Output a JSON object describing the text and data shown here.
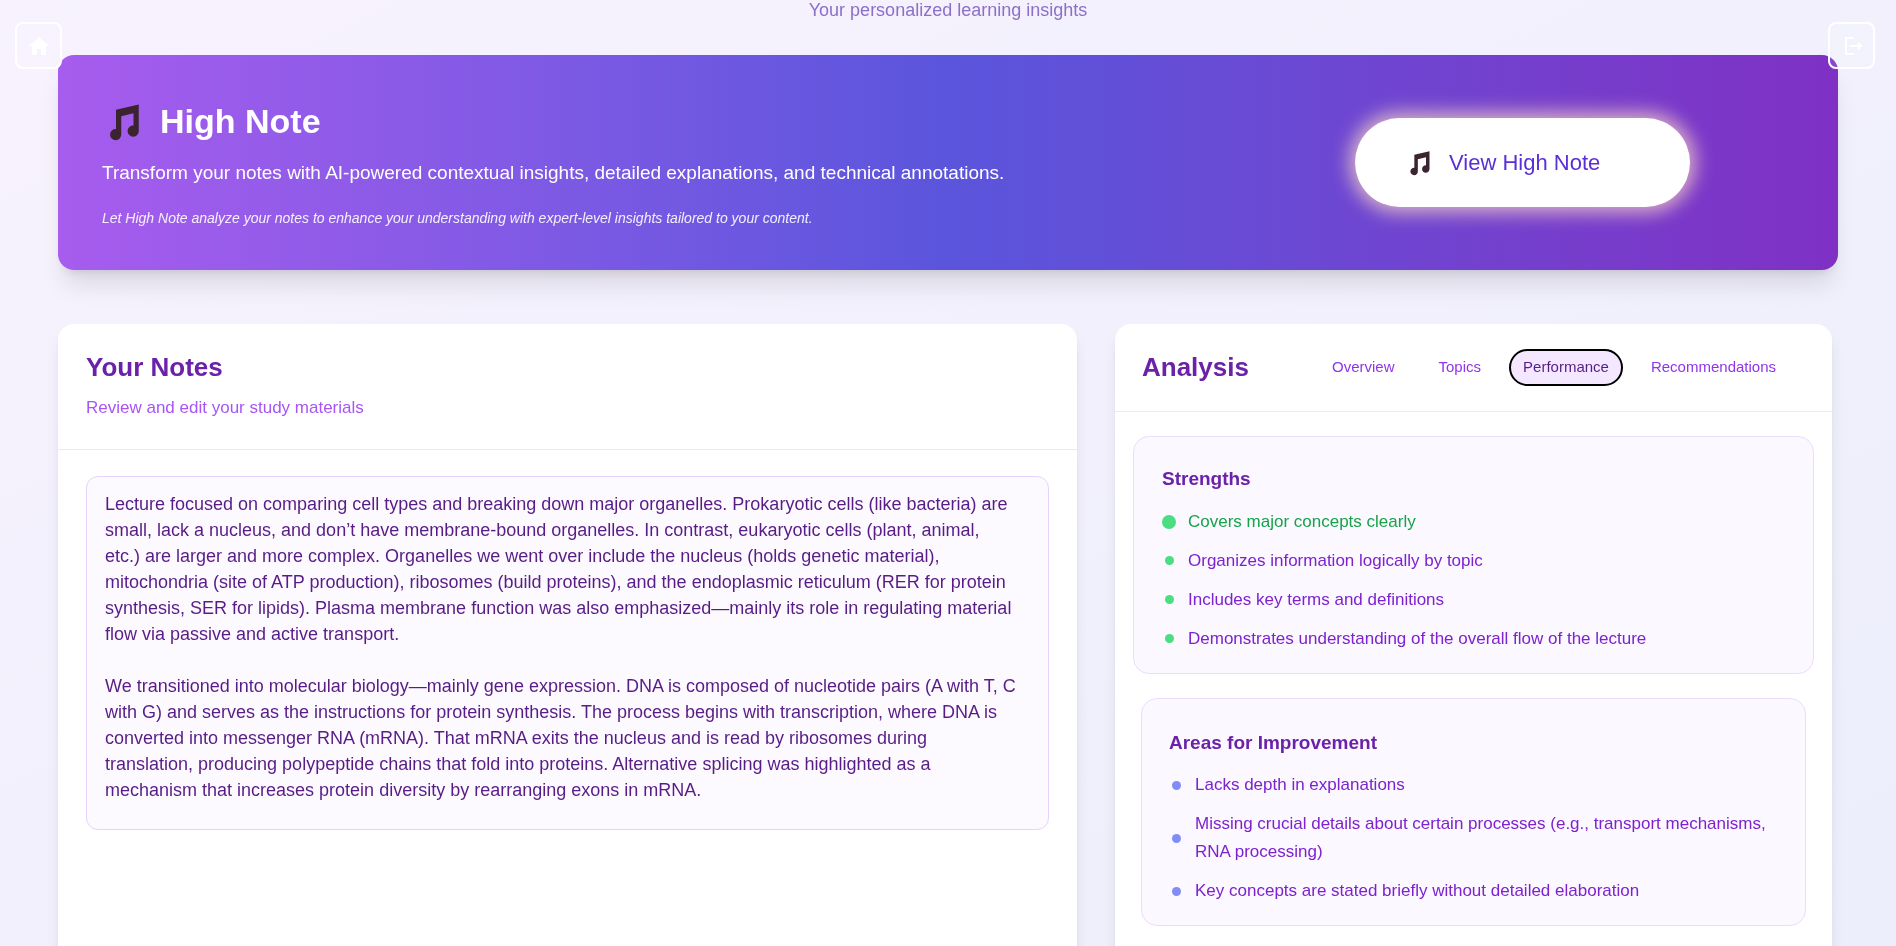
{
  "header": {
    "subtitle": "Your personalized learning insights"
  },
  "hero": {
    "title": "High Note",
    "description": "Transform your notes with AI-powered contextual insights, detailed explanations, and technical annotations.",
    "note": "Let High Note analyze your notes to enhance your understanding with expert-level insights tailored to your content.",
    "button": "View High Note"
  },
  "notes": {
    "title": "Your Notes",
    "subtitle": "Review and edit your study materials",
    "value": "Lecture focused on comparing cell types and breaking down major organelles. Prokaryotic cells (like bacteria) are small, lack a nucleus, and don’t have membrane-bound organelles. In contrast, eukaryotic cells (plant, animal, etc.) are larger and more complex. Organelles we went over include the nucleus (holds genetic material), mitochondria (site of ATP production), ribosomes (build proteins), and the endoplasmic reticulum (RER for protein synthesis, SER for lipids). Plasma membrane function was also emphasized—mainly its role in regulating material flow via passive and active transport.\n\nWe transitioned into molecular biology—mainly gene expression. DNA is composed of nucleotide pairs (A with T, C with G) and serves as the instructions for protein synthesis. The process begins with transcription, where DNA is converted into messenger RNA (mRNA). That mRNA exits the nucleus and is read by ribosomes during translation, producing polypeptide chains that fold into proteins. Alternative splicing was highlighted as a mechanism that increases protein diversity by rearranging exons in mRNA."
  },
  "analysis": {
    "title": "Analysis",
    "tabs": [
      {
        "label": "Overview",
        "selected": false
      },
      {
        "label": "Topics",
        "selected": false
      },
      {
        "label": "Performance",
        "selected": true
      },
      {
        "label": "Recommendations",
        "selected": false
      }
    ],
    "sections": [
      {
        "title": "Strengths",
        "color": "#4ade80",
        "items": [
          {
            "text": "Covers major concepts clearly",
            "highlighted": true
          },
          {
            "text": "Organizes information logically by topic",
            "highlighted": false
          },
          {
            "text": "Includes key terms and definitions",
            "highlighted": false
          },
          {
            "text": "Demonstrates understanding of the overall flow of the lecture",
            "highlighted": false
          }
        ]
      },
      {
        "title": "Areas for Improvement",
        "color": "#818cf8",
        "items": [
          {
            "text": "Lacks depth in explanations",
            "highlighted": false
          },
          {
            "text": "Missing crucial details about certain processes (e.g., transport mechanisms, RNA processing)",
            "highlighted": false
          },
          {
            "text": "Key concepts are stated briefly without detailed elaboration",
            "highlighted": false
          }
        ]
      }
    ]
  }
}
